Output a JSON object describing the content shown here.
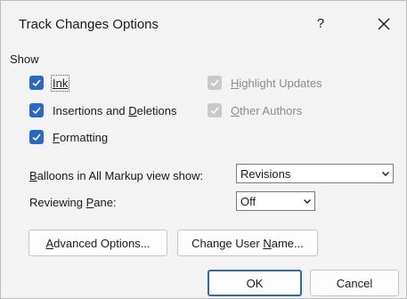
{
  "dialog": {
    "title": "Track Changes Options",
    "help_label": "?"
  },
  "show_group": {
    "label": "Show",
    "ink": {
      "label": "Ink",
      "checked": true
    },
    "insertions": {
      "label_pre": "Insertions and ",
      "label_key": "D",
      "label_post": "eletions",
      "checked": true
    },
    "formatting": {
      "label_key": "F",
      "label_post": "ormatting",
      "checked": true
    },
    "highlight": {
      "label_key": "H",
      "label_post": "ighlight Updates",
      "checked": true,
      "enabled": false
    },
    "other_authors": {
      "label_key": "O",
      "label_post": "ther Authors",
      "checked": true,
      "enabled": false
    }
  },
  "balloons": {
    "label_key": "B",
    "label_post": "alloons in All Markup view show:",
    "value": "Revisions"
  },
  "reviewing_pane": {
    "label_pre": "Reviewing ",
    "label_key": "P",
    "label_post": "ane:",
    "value": "Off"
  },
  "buttons": {
    "advanced_key": "A",
    "advanced_post": "dvanced Options...",
    "change_pre": "Change User ",
    "change_key": "N",
    "change_post": "ame...",
    "ok": "OK",
    "cancel": "Cancel"
  },
  "colors": {
    "accent": "#2a67c7",
    "disabled": "#c9c9c9"
  }
}
